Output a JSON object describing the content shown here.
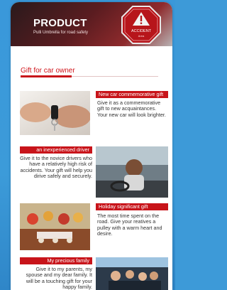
{
  "header": {
    "title": "PRODUCT",
    "subtitle": "Pulli Umbrella for road safety",
    "badge_text": "ACCIDENT",
    "badge_small": "Area"
  },
  "section": {
    "title": "Gift for car owner"
  },
  "items": [
    {
      "tag": "New car commemorative gift",
      "desc": "Give it as a commemorative gift  to new acquaintances. Your new car will look brighter."
    },
    {
      "tag": "an inexperienced driver",
      "desc": "Give it to the novice drivers who have a relatively high risk of accidents. Your gift will help you dirive safely and securely."
    },
    {
      "tag": "Holiday significant gift",
      "desc": "The most time spent on the road. Give your reatives a pulley with a warm heart and desire."
    },
    {
      "tag": "My precious family",
      "desc": "Give it to my parents, my spouse and my dear family. It will be a touching gift for your happy family."
    }
  ],
  "colors": {
    "accent": "#c8141a",
    "background": "#3d9ad8",
    "header_dark": "#5a1c20"
  }
}
